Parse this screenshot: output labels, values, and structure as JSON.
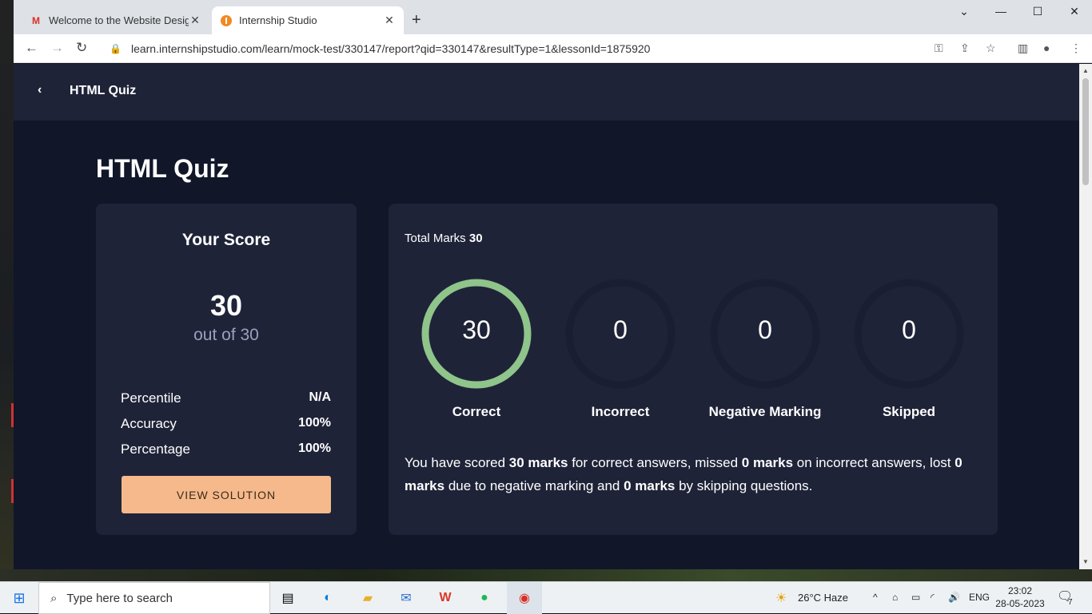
{
  "browser": {
    "tabs": [
      {
        "title": "Welcome to the Website Design",
        "favicon": "gmail-icon",
        "active": false
      },
      {
        "title": "Internship Studio",
        "favicon": "internship-studio-icon",
        "active": true
      }
    ],
    "url": "learn.internshipstudio.com/learn/mock-test/330147/report?qid=330147&resultType=1&lessonId=1875920"
  },
  "topnav": {
    "title": "HTML Quiz"
  },
  "page": {
    "heading": "HTML Quiz"
  },
  "score_card": {
    "heading": "Your Score",
    "score": "30",
    "out_of": "out of 30",
    "stats": [
      {
        "label": "Percentile",
        "value": "N/A"
      },
      {
        "label": "Accuracy",
        "value": "100%"
      },
      {
        "label": "Percentage",
        "value": "100%"
      }
    ],
    "button": "VIEW SOLUTION"
  },
  "marks_card": {
    "total_label": "Total Marks",
    "total_value": "30",
    "rings": [
      {
        "value": "30",
        "label": "Correct",
        "fill_fraction": 1.0,
        "color": "#8fc48a"
      },
      {
        "value": "0",
        "label": "Incorrect",
        "fill_fraction": 0,
        "color": "#1a1e33"
      },
      {
        "value": "0",
        "label": "Negative Marking",
        "fill_fraction": 0,
        "color": "#1a1e33"
      },
      {
        "value": "0",
        "label": "Skipped",
        "fill_fraction": 0,
        "color": "#1a1e33"
      }
    ],
    "summary": {
      "p1": "You have scored ",
      "b1": "30 marks",
      "p2": " for correct answers, missed ",
      "b2": "0 marks",
      "p3": " on incorrect answers, lost ",
      "b3": "0 marks",
      "p4": " due to negative marking and ",
      "b4": "0 marks",
      "p5": " by skipping questions."
    }
  },
  "taskbar": {
    "search_placeholder": "Type here to search",
    "weather": "26°C  Haze",
    "language": "ENG",
    "time": "23:02",
    "date": "28-05-2023",
    "notification_count": "7"
  },
  "colors": {
    "accent": "#f5b98b",
    "correct": "#8fc48a",
    "bg": "#121629",
    "card": "#1f2338"
  }
}
